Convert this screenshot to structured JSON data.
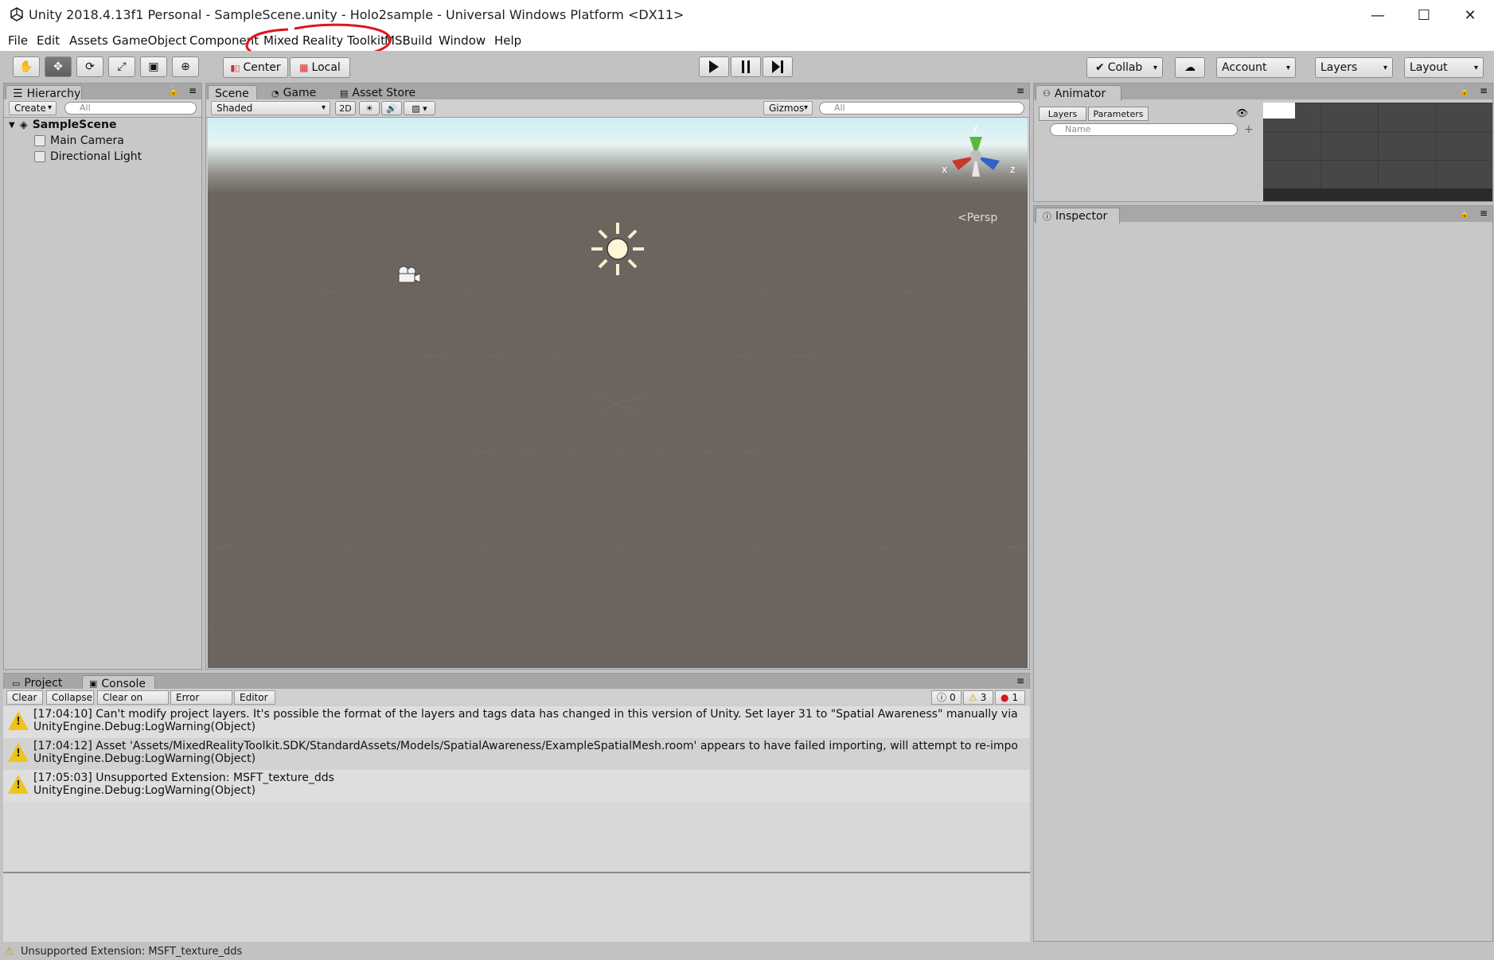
{
  "window": {
    "title": "Unity 2018.4.13f1 Personal - SampleScene.unity - Holo2sample - Universal Windows Platform <DX11>",
    "controls": {
      "minimize": "—",
      "maximize": "☐",
      "close": "✕"
    }
  },
  "menu": {
    "items": [
      "File",
      "Edit",
      "Assets",
      "GameObject",
      "Component",
      "Mixed Reality Toolkit",
      "MSBuild",
      "Window",
      "Help"
    ]
  },
  "toolbar": {
    "pivot": "Center",
    "space": "Local",
    "collab": "Collab",
    "account": "Account",
    "layers": "Layers",
    "layout": "Layout"
  },
  "hierarchy": {
    "tab": "Hierarchy",
    "create": "Create",
    "search_placeholder": "All",
    "scene": "SampleScene",
    "items": [
      "Main Camera",
      "Directional Light"
    ]
  },
  "scene_view": {
    "tabs": [
      "Scene",
      "Game",
      "Asset Store"
    ],
    "shading": "Shaded",
    "mode_2d": "2D",
    "gizmos": "Gizmos",
    "search_placeholder": "All",
    "persp": "Persp",
    "axes": {
      "y": "y",
      "x": "x",
      "z": "z"
    }
  },
  "animator": {
    "tab": "Animator",
    "subtabs": [
      "Layers",
      "Parameters"
    ],
    "search_placeholder": "Name"
  },
  "inspector": {
    "tab": "Inspector"
  },
  "console": {
    "tabs": [
      "Project",
      "Console"
    ],
    "buttons": [
      "Clear",
      "Collapse",
      "Clear on Play",
      "Error Pause",
      "Editor"
    ],
    "counts": {
      "info": "0",
      "warnings": "3",
      "errors": "1"
    },
    "messages": [
      {
        "line1": "[17:04:10] Can't modify project layers. It's possible the format of the layers and tags data has changed in this version of Unity. Set layer 31 to \"Spatial Awareness\" manually via",
        "line2": "UnityEngine.Debug:LogWarning(Object)"
      },
      {
        "line1": "[17:04:12] Asset 'Assets/MixedRealityToolkit.SDK/StandardAssets/Models/SpatialAwareness/ExampleSpatialMesh.room' appears to have failed importing, will attempt to re-impo",
        "line2": "UnityEngine.Debug:LogWarning(Object)"
      },
      {
        "line1": "[17:05:03] Unsupported Extension: MSFT_texture_dds",
        "line2": "UnityEngine.Debug:LogWarning(Object)"
      }
    ]
  },
  "statusbar": {
    "text": "Unsupported Extension: MSFT_texture_dds"
  },
  "colors": {
    "annotation": "#e0141e",
    "warning": "#f1c21b",
    "error": "#d9141b"
  }
}
